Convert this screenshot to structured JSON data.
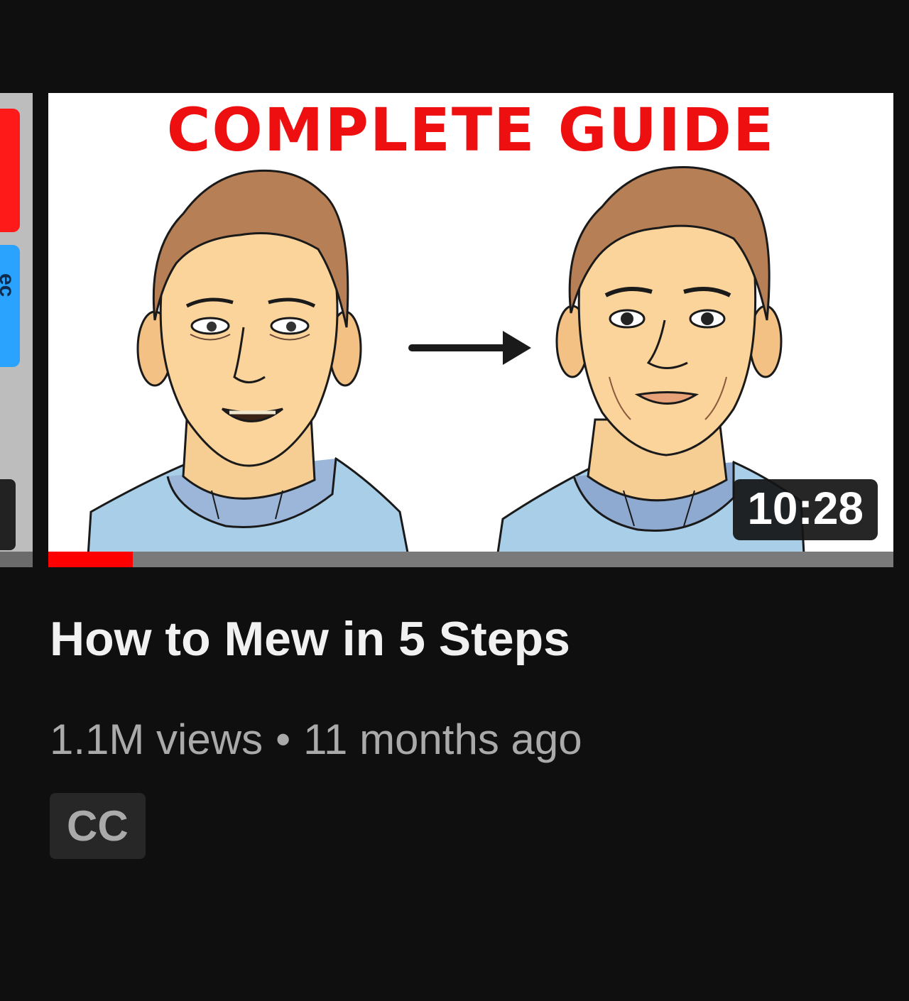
{
  "previous_card": {
    "partial_letters": "ec"
  },
  "video": {
    "thumbnail": {
      "headline": "COMPLETE GUIDE",
      "headline_color": "#ee1010",
      "illustration": "before-after-face-illustration",
      "arrow": "right-arrow-icon"
    },
    "duration": "10:28",
    "watch_progress": 0.1,
    "title": "How to Mew in 5 Steps",
    "views": "1.1M views",
    "separator": "•",
    "age": "11 months ago",
    "badge": "CC"
  },
  "colors": {
    "background": "#0f0f0f",
    "progress": "#ff0000",
    "title": "#f1f1f1",
    "meta": "#aaaaaa"
  }
}
